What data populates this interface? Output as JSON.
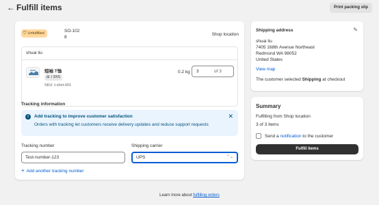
{
  "header": {
    "back_icon": "←",
    "title": "Fulfill items",
    "print_label": "Print packing slip"
  },
  "order": {
    "status_badge": "Unfulfilled",
    "status_icon": "⛉",
    "order_id": "SO-1028",
    "location": "Shop location",
    "customer_name": "shuai liu",
    "item": {
      "name": "短袖 T恤",
      "variant_icon": "⊟",
      "variant": "/ 3XS",
      "sku": "SKU: t-shirt-001",
      "weight": "0.2 kg",
      "quantity": "3",
      "quantity_of": "of 3"
    }
  },
  "tracking": {
    "heading": "Tracking information",
    "banner_icon": "i",
    "banner_title": "Add tracking to improve customer satisfaction",
    "banner_body": "Orders with tracking let customers receive delivery updates and reduce support requests",
    "banner_close": "✕",
    "number_label": "Tracking number",
    "number_value": "Test-number-123",
    "carrier_label": "Shipping carrier",
    "carrier_value": "UPS",
    "carrier_caret": "⌃⌄",
    "add_icon": "+",
    "add_label": "Add another tracking number"
  },
  "shipping": {
    "title": "Shipping address",
    "edit_icon": "✎",
    "address": [
      "shuai liu",
      "7405 168th Avenue Northeast",
      "Redmond WA 98052",
      "United States"
    ],
    "view_map": "View map",
    "note_prefix": "The customer selected ",
    "note_bold": "Shipping",
    "note_suffix": " at checkout"
  },
  "summary": {
    "title": "Summary",
    "from": "Fulfilling from Shop location",
    "count": "3 of 3 items",
    "send_prefix": "Send a ",
    "send_link": "notification",
    "send_suffix": " to the customer",
    "fulfill_label": "Fulfill items"
  },
  "footer": {
    "prefix": "Learn more about ",
    "link": "fulfilling orders"
  },
  "colors": {
    "accent": "#005bd3",
    "badge_bg": "#ffd79d",
    "banner_bg": "#eaf4ff",
    "primary_button": "#303030"
  }
}
